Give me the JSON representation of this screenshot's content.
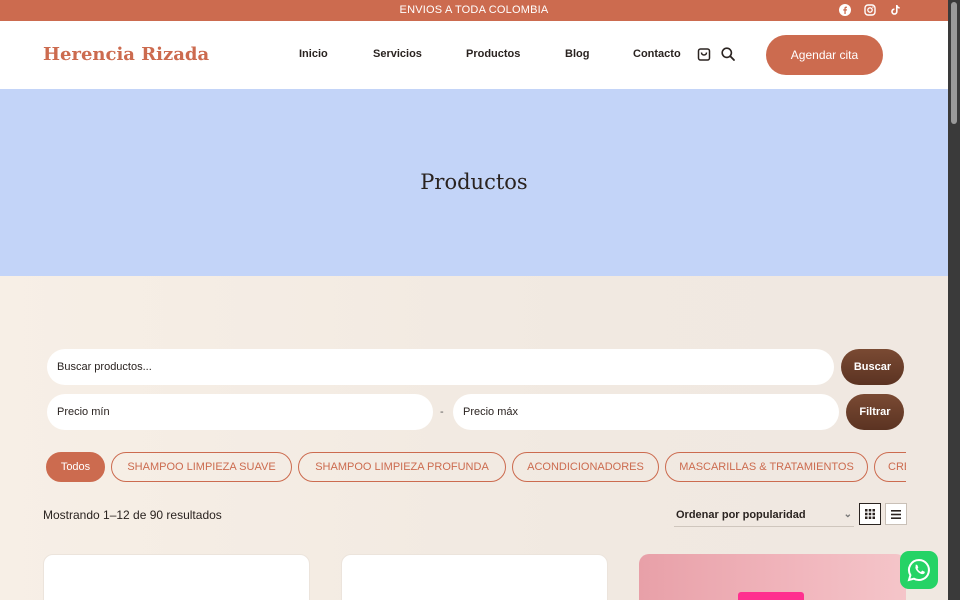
{
  "topbar": {
    "notice": "ENVIOS A TODA COLOMBIA",
    "social_icons": [
      "facebook-icon",
      "instagram-icon",
      "tiktok-icon"
    ]
  },
  "header": {
    "logo": "Herencia Rizada",
    "nav": [
      "Inicio",
      "Servicios",
      "Productos",
      "Blog",
      "Contacto"
    ],
    "cta": "Agendar cita",
    "icons": [
      "cart-icon",
      "search-icon"
    ]
  },
  "hero": {
    "title": "Productos"
  },
  "filters": {
    "search_placeholder": "Buscar productos...",
    "search_button": "Buscar",
    "price_min_placeholder": "Precio mín",
    "price_separator": "-",
    "price_max_placeholder": "Precio máx",
    "filter_button": "Filtrar"
  },
  "categories": [
    "Todos",
    "SHAMPOO LIMPIEZA SUAVE",
    "SHAMPOO LIMPIEZA PROFUNDA",
    "ACONDICIONADORES",
    "MASCARILLAS & TRATAMIENTOS",
    "CREMAS"
  ],
  "results": {
    "count_text": "Mostrando 1–12 de 90 resultados",
    "sort_selected": "Ordenar por popularidad"
  },
  "colors": {
    "brand": "#cc6b4f",
    "hero_bg": "#c3d4f8",
    "page_bg": "#f6efe7",
    "button_brown": "#6a3d2a",
    "whatsapp": "#25d366"
  }
}
